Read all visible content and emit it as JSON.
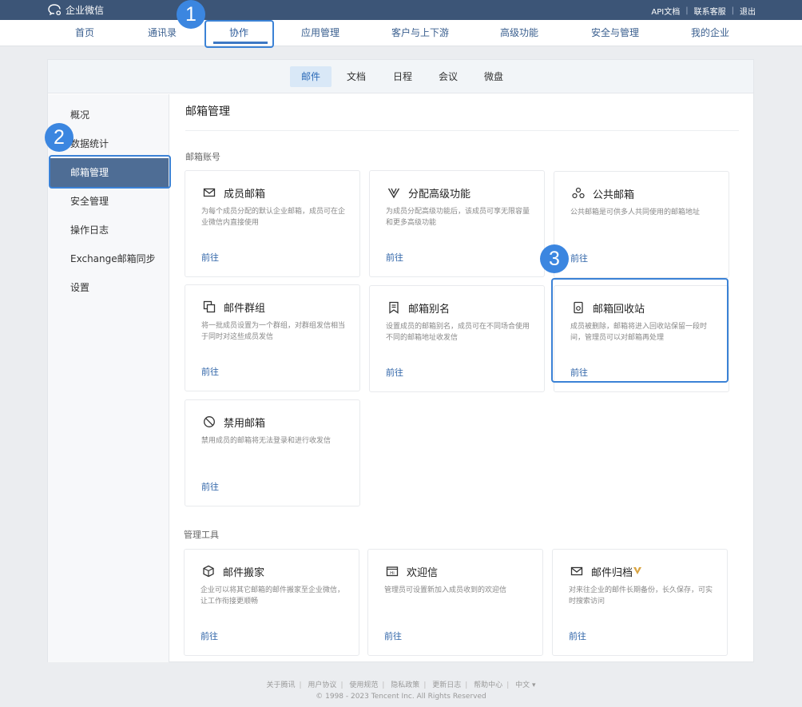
{
  "brand": {
    "name": "企业微信",
    "logo_icon": "wecom-logo-icon"
  },
  "top_links": [
    "API文档",
    "联系客服",
    "退出"
  ],
  "nav": {
    "items": [
      "首页",
      "通讯录",
      "协作",
      "应用管理",
      "客户与上下游",
      "高级功能",
      "安全与管理",
      "我的企业"
    ],
    "active_index": 2
  },
  "markers": [
    "1",
    "2",
    "3"
  ],
  "subtabs": {
    "items": [
      "邮件",
      "文档",
      "日程",
      "会议",
      "微盘"
    ],
    "active_index": 0
  },
  "sidebar": {
    "items": [
      "概况",
      "数据统计",
      "邮箱管理",
      "安全管理",
      "操作日志",
      "Exchange邮箱同步",
      "设置"
    ],
    "active_index": 2
  },
  "content": {
    "title": "邮箱管理",
    "sections": {
      "accounts": "邮箱账号",
      "tools": "管理工具"
    },
    "link_label": "前往",
    "cards": [
      {
        "title": "成员邮箱",
        "desc": "为每个成员分配的默认企业邮箱，成员可在企业微信内直接使用",
        "icon": "envelope-icon"
      },
      {
        "title": "分配高级功能",
        "desc": "为成员分配高级功能后，该成员可享无限容量和更多高级功能",
        "icon": "v-badge-icon"
      },
      {
        "title": "公共邮箱",
        "desc": "公共邮箱是可供多人共同使用的邮箱地址",
        "icon": "shared-users-icon"
      },
      {
        "title": "邮件群组",
        "desc": "将一批成员设置为一个群组，对群组发信相当于同时对这些成员发信",
        "icon": "group-icon"
      },
      {
        "title": "邮箱别名",
        "desc": "设置成员的邮箱别名，成员可在不同场合使用不同的邮箱地址收发信",
        "icon": "alias-icon"
      },
      {
        "title": "邮箱回收站",
        "desc": "成员被删除，邮箱将进入回收站保留一段时间，管理员可以对邮箱再处理",
        "icon": "recycle-bin-icon"
      },
      {
        "title": "禁用邮箱",
        "desc": "禁用成员的邮箱将无法登录和进行收发信",
        "icon": "ban-icon"
      }
    ],
    "tool_cards": [
      {
        "title": "邮件搬家",
        "desc": "企业可以将其它邮箱的邮件搬家至企业微信，让工作衔接更顺畅",
        "icon": "cube-icon"
      },
      {
        "title": "欢迎信",
        "desc": "管理员可设置新加入成员收到的欢迎信",
        "icon": "welcome-letter-icon"
      },
      {
        "title": "邮件归档",
        "desc": "对来往企业的邮件长期备份，长久保存，可实时搜索访问",
        "icon": "archive-envelope-icon",
        "vip_icon": "vip-crown-icon"
      }
    ]
  },
  "footer": {
    "links": [
      "关于腾讯",
      "用户协议",
      "使用规范",
      "隐私政策",
      "更新日志",
      "帮助中心",
      "中文 ▾"
    ],
    "copyright": "© 1998 - 2023 Tencent Inc. All Rights Reserved"
  },
  "colors": {
    "topbar": "#3c5577",
    "accent": "#3b82d6",
    "sidebar_active": "#4e6d95",
    "link": "#2f64a8"
  }
}
